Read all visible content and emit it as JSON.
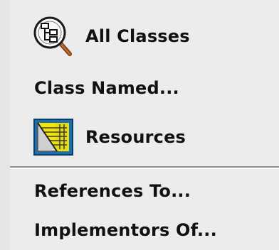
{
  "menu": {
    "items": [
      {
        "label": "All Classes",
        "icon": "class-hierarchy-magnifier-icon"
      },
      {
        "label": "Class Named..."
      },
      {
        "label": "Resources",
        "icon": "resources-image-icon"
      }
    ],
    "secondary_items": [
      {
        "label": "References To..."
      },
      {
        "label": "Implementors Of..."
      }
    ]
  },
  "colors": {
    "background": "#ececec",
    "text": "#111111",
    "separator_dark": "#8e8e8e",
    "separator_light": "#ffffff",
    "icon_yellow": "#f4e600",
    "icon_blue": "#1a6fb0"
  }
}
